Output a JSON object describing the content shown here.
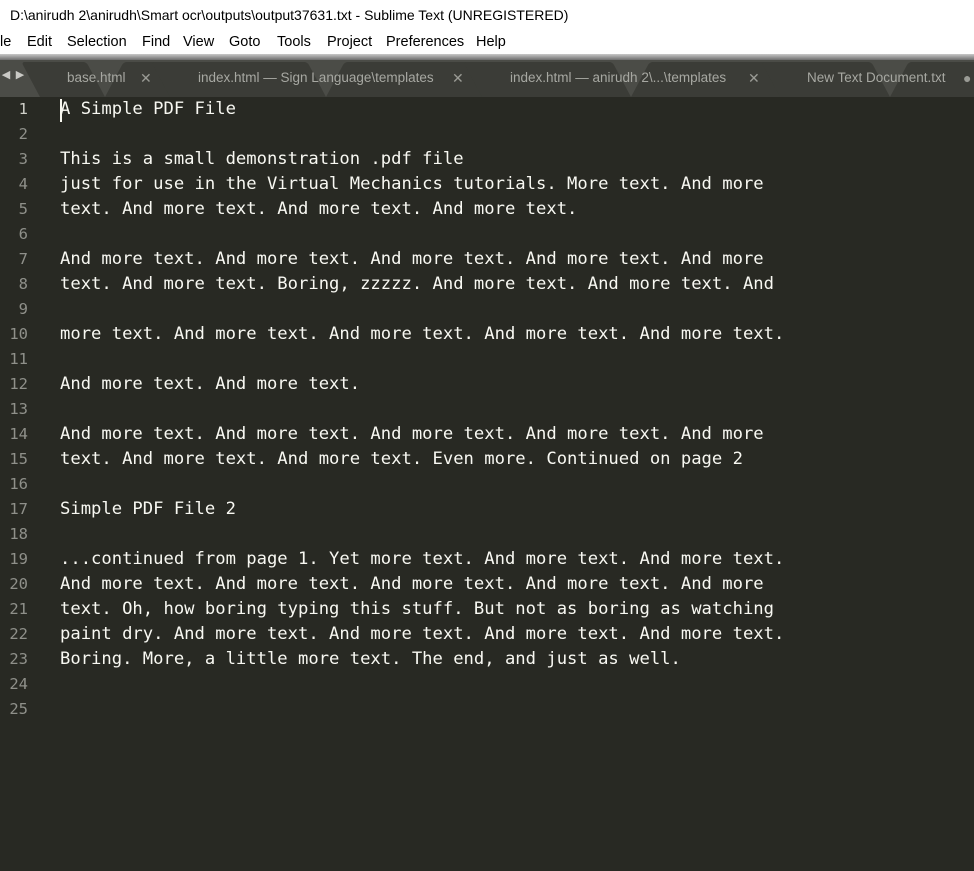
{
  "window": {
    "title": "D:\\anirudh 2\\anirudh\\Smart ocr\\outputs\\output37631.txt - Sublime Text (UNREGISTERED)"
  },
  "menu": {
    "items": [
      "le",
      "Edit",
      "Selection",
      "Find",
      "View",
      "Goto",
      "Tools",
      "Project",
      "Preferences",
      "Help"
    ]
  },
  "tabs": {
    "nav_left": "◀",
    "nav_right": "▶",
    "items": [
      {
        "label": "base.html",
        "close": "✕"
      },
      {
        "label": "index.html — Sign Language\\templates",
        "close": "✕"
      },
      {
        "label": "index.html — anirudh 2\\...\\templates",
        "close": "✕"
      },
      {
        "label": "New Text Document.txt",
        "close": "●"
      }
    ]
  },
  "editor": {
    "line_numbers": [
      "1",
      "2",
      "3",
      "4",
      "5",
      "6",
      "7",
      "8",
      "9",
      "10",
      "11",
      "12",
      "13",
      "14",
      "15",
      "16",
      "17",
      "18",
      "19",
      "20",
      "21",
      "22",
      "23",
      "24",
      "25"
    ],
    "lines": [
      "A Simple PDF File",
      "",
      "This is a small demonstration .pdf file",
      "just for use in the Virtual Mechanics tutorials. More text. And more",
      "text. And more text. And more text. And more text.",
      "",
      "And more text. And more text. And more text. And more text. And more",
      "text. And more text. Boring, zzzzz. And more text. And more text. And",
      "",
      "more text. And more text. And more text. And more text. And more text.",
      "",
      "And more text. And more text.",
      "",
      "And more text. And more text. And more text. And more text. And more",
      "text. And more text. And more text. Even more. Continued on page 2",
      "",
      "Simple PDF File 2",
      "",
      "...continued from page 1. Yet more text. And more text. And more text.",
      "And more text. And more text. And more text. And more text. And more",
      "text. Oh, how boring typing this stuff. But not as boring as watching",
      "paint dry. And more text. And more text. And more text. And more text.",
      "Boring. More, a little more text. The end, and just as well.",
      "",
      ""
    ]
  },
  "colors": {
    "editor_bg": "#282923",
    "text": "#f8f8f2",
    "gutter_text": "#8f908a",
    "tabbar_bg": "#4b4c47"
  }
}
